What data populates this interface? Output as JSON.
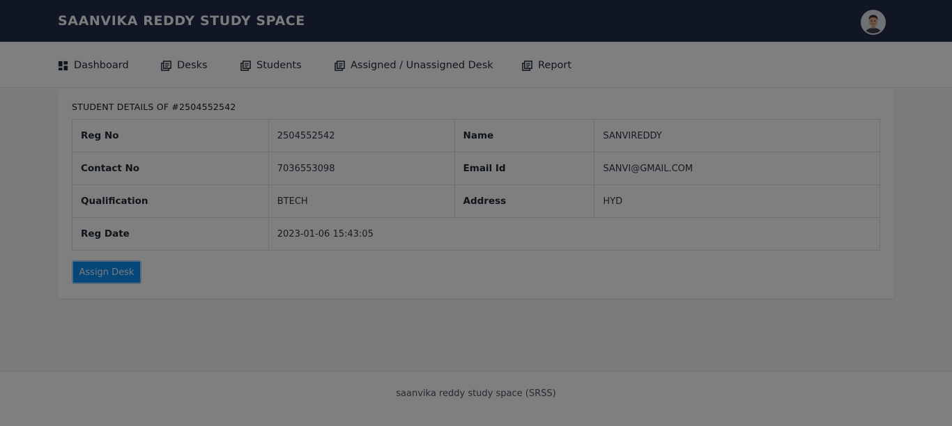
{
  "header": {
    "brand": "SAANVIKA REDDY STUDY SPACE",
    "avatar_icon": "user-avatar-icon"
  },
  "nav": {
    "items": [
      {
        "label": "Dashboard",
        "icon": "dashboard-icon"
      },
      {
        "label": "Desks",
        "icon": "book-stack-icon"
      },
      {
        "label": "Students",
        "icon": "book-stack-icon"
      },
      {
        "label": "Assigned / Unassigned Desk",
        "icon": "book-stack-icon"
      },
      {
        "label": "Report",
        "icon": "book-stack-icon"
      }
    ]
  },
  "details": {
    "title": "STUDENT DETAILS OF #2504552542",
    "rows": [
      {
        "label1": "Reg No",
        "value1": "2504552542",
        "label2": "Name",
        "value2": "SANVIREDDY"
      },
      {
        "label1": "Contact No",
        "value1": "7036553098",
        "label2": "Email Id",
        "value2": "SANVI@GMAIL.COM"
      },
      {
        "label1": "Qualification",
        "value1": "BTECH",
        "label2": "Address",
        "value2": "HYD"
      },
      {
        "label1": "Reg Date",
        "value1": "2023-01-06 15:43:05"
      }
    ],
    "assign_button": "Assign Desk"
  },
  "footer": {
    "text": "saanvika reddy study space (SRSS)"
  },
  "colors": {
    "header_bg": "#202c46",
    "primary_button": "#0d8ff2",
    "overlay": "rgba(0,0,0,0.5)"
  }
}
